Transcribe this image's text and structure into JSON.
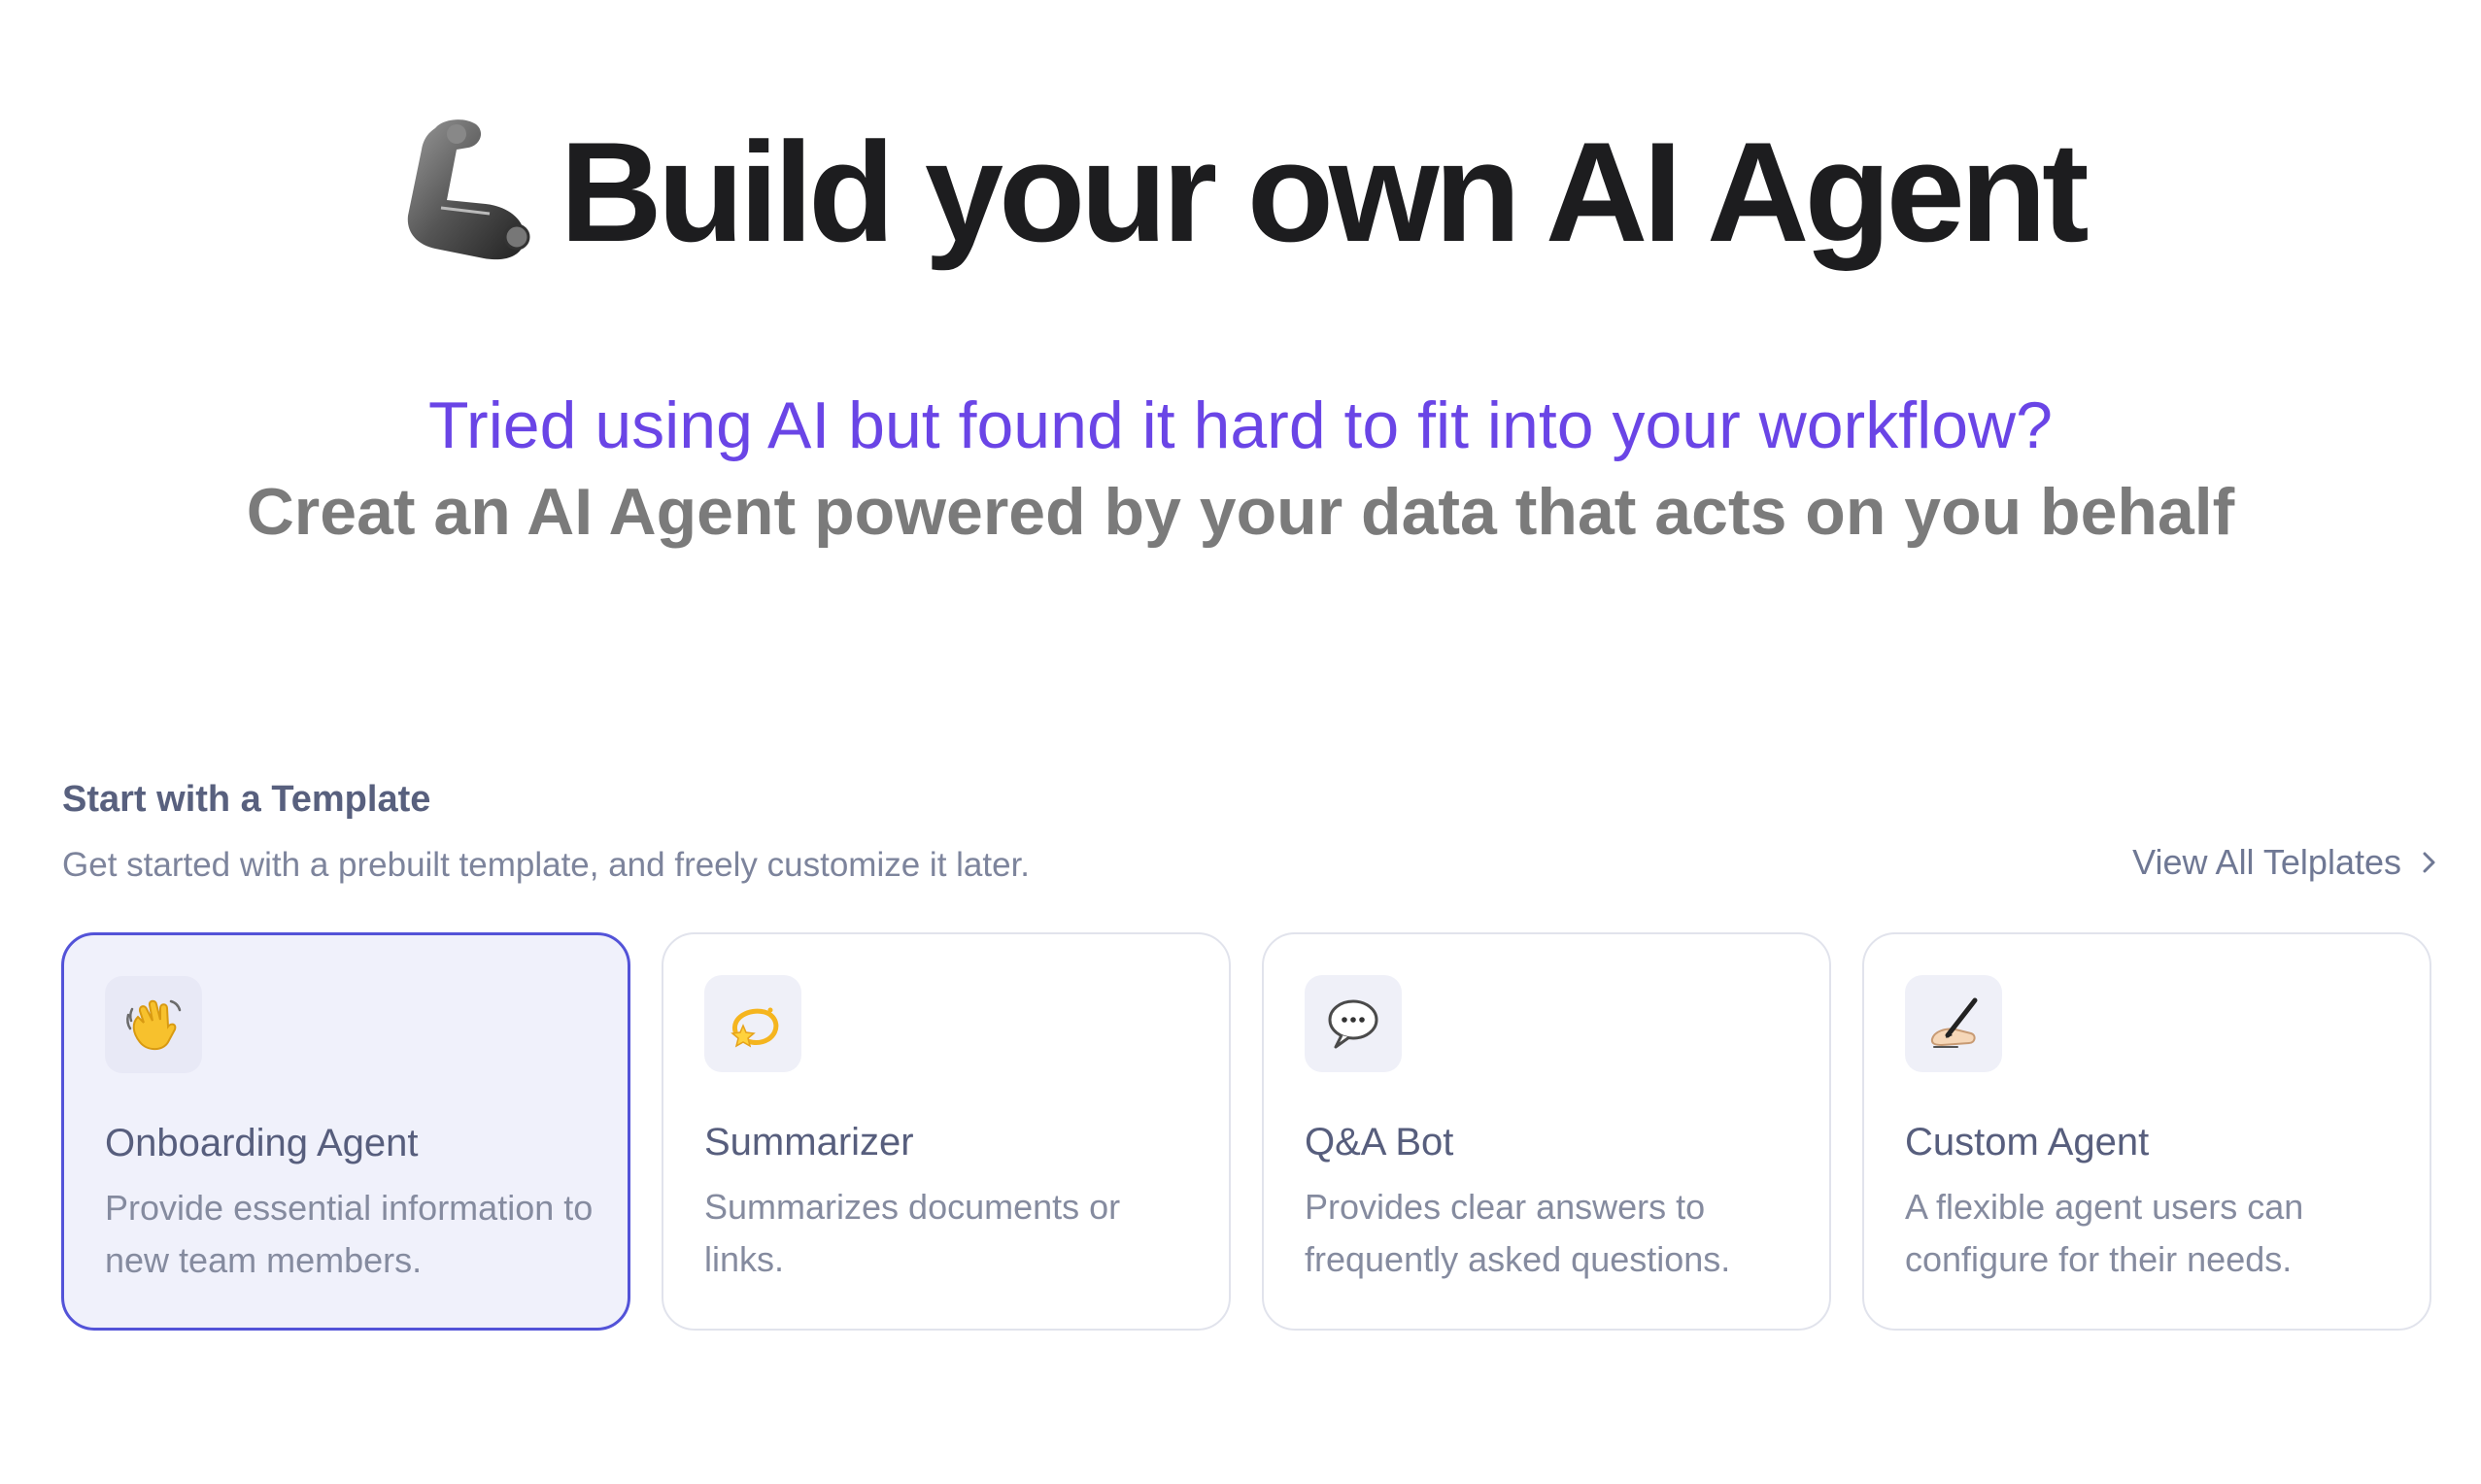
{
  "hero": {
    "icon": "mechanical-arm-icon",
    "title": "Build your own AI Agent"
  },
  "subtitle": {
    "line1": "Tried using AI but found it hard to fit into your workflow?",
    "line2": "Creat an AI Agent powered by your data that acts on you behalf"
  },
  "templates": {
    "heading": "Start with a Template",
    "description": "Get started with a prebuilt template, and freely customize it later.",
    "view_all_label": "View All Telplates",
    "items": [
      {
        "icon": "waving-hand-icon",
        "title": "Onboarding Agent",
        "description": "Provide essential information to new team members.",
        "selected": true
      },
      {
        "icon": "dizzy-star-icon",
        "title": "Summarizer",
        "description": "Summarizes documents or links.",
        "selected": false
      },
      {
        "icon": "speech-balloon-icon",
        "title": "Q&A Bot",
        "description": "Provides clear answers to frequently asked questions.",
        "selected": false
      },
      {
        "icon": "writing-hand-icon",
        "title": "Custom Agent",
        "description": "A flexible agent users can configure for their needs.",
        "selected": false
      }
    ]
  },
  "colors": {
    "accent_purple": "#6a45e6",
    "selected_border": "#5353d8",
    "selected_background": "#f0f1fb"
  }
}
